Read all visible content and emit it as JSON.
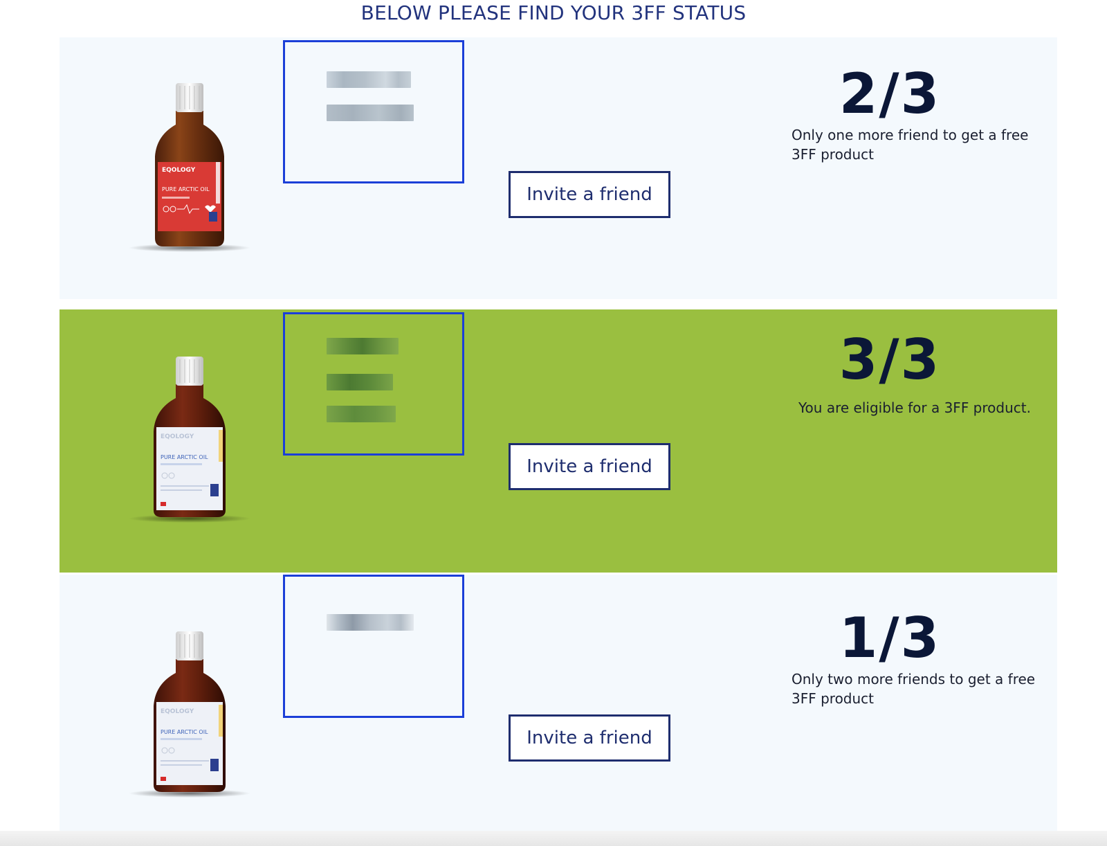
{
  "page": {
    "title": "BELOW PLEASE FIND YOUR 3FF STATUS"
  },
  "colors": {
    "accent_blue": "#1b3fd8",
    "navy": "#1e2d6e",
    "highlight_green": "#9abf40",
    "row_background": "#f4f9fd"
  },
  "rows": [
    {
      "status": "2/3",
      "message": "Only one more friend to get a free 3FF product",
      "invite_label": "Invite a friend",
      "product_icon": "red-oil-bottle-icon",
      "highlighted": false
    },
    {
      "status": "3/3",
      "message": "You are eligible for a 3FF product.",
      "invite_label": "Invite a friend",
      "product_icon": "white-oil-bottle-icon",
      "highlighted": true
    },
    {
      "status": "1/3",
      "message": "Only two more friends to get a free 3FF product",
      "invite_label": "Invite a friend",
      "product_icon": "white-oil-bottle-icon",
      "highlighted": false
    }
  ]
}
